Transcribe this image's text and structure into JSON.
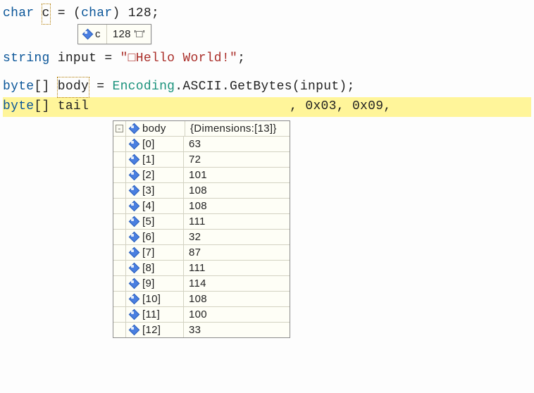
{
  "line1": {
    "kw_char1": "char",
    "varname": "c",
    "eq": " = (",
    "kw_char2": "char",
    "rest": ") 128;"
  },
  "tip_c": {
    "name": "c",
    "value": "128 '□'"
  },
  "line2": {
    "kw_string": "string",
    "rest1": " input = ",
    "str": "\"□Hello World!\"",
    "rest2": ";"
  },
  "line3": {
    "kw_byte": "byte",
    "rest1": "[] ",
    "var": "body",
    "rest2": " = ",
    "cls": "Encoding",
    "rest3": ".ASCII.GetBytes(input);"
  },
  "line4": {
    "kw_byte": "byte",
    "rest1": "[] tail",
    "tail_hex": ", 0x03, 0x09,"
  },
  "tip_body": {
    "name": "body",
    "dims": "{Dimensions:[13]}",
    "minus": "-",
    "rows": [
      {
        "key": "[0]",
        "val": "63"
      },
      {
        "key": "[1]",
        "val": "72"
      },
      {
        "key": "[2]",
        "val": "101"
      },
      {
        "key": "[3]",
        "val": "108"
      },
      {
        "key": "[4]",
        "val": "108"
      },
      {
        "key": "[5]",
        "val": "111"
      },
      {
        "key": "[6]",
        "val": "32"
      },
      {
        "key": "[7]",
        "val": "87"
      },
      {
        "key": "[8]",
        "val": "111"
      },
      {
        "key": "[9]",
        "val": "114"
      },
      {
        "key": "[10]",
        "val": "108"
      },
      {
        "key": "[11]",
        "val": "100"
      },
      {
        "key": "[12]",
        "val": "33"
      }
    ]
  }
}
